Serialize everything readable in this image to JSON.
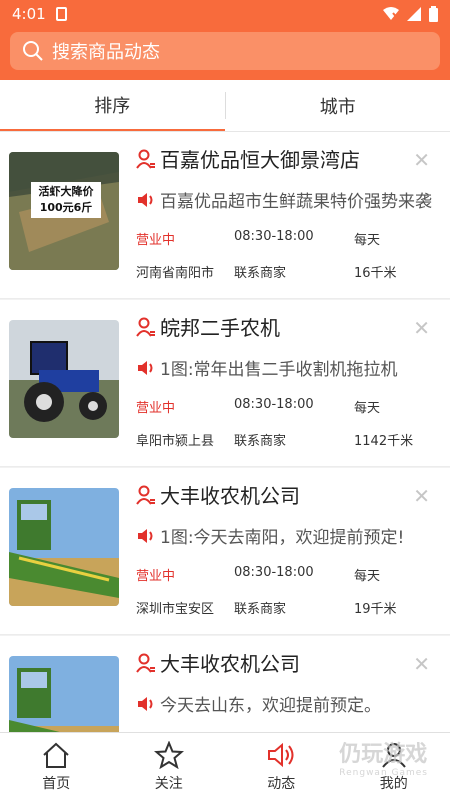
{
  "status_bar": {
    "time": "4:01"
  },
  "search": {
    "placeholder": "搜索商品动态"
  },
  "tabs": [
    {
      "label": "排序"
    },
    {
      "label": "城市"
    }
  ],
  "colors": {
    "accent": "#f86b3c",
    "open_status": "#e2312b"
  },
  "listings": [
    {
      "name": "百嘉优品恒大御景湾店",
      "promo": "百嘉优品超市生鲜蔬果特价强势来袭",
      "status": "营业中",
      "hours": "08:30-18:00",
      "days": "每天",
      "location": "河南省南阳市",
      "contact": "联系商家",
      "distance": "16千米",
      "image_text_line1": "活虾大降价",
      "image_text_line2": "100元6斤"
    },
    {
      "name": "皖邦二手农机",
      "promo": "1图:常年出售二手收割机拖拉机",
      "status": "营业中",
      "hours": "08:30-18:00",
      "days": "每天",
      "location": "阜阳市颍上县",
      "contact": "联系商家",
      "distance": "1142千米"
    },
    {
      "name": "大丰收农机公司",
      "promo": "1图:今天去南阳，欢迎提前预定!",
      "status": "营业中",
      "hours": "08:30-18:00",
      "days": "每天",
      "location": "深圳市宝安区",
      "contact": "联系商家",
      "distance": "19千米"
    },
    {
      "name": "大丰收农机公司",
      "promo": "今天去山东，欢迎提前预定。"
    }
  ],
  "bottom_nav": [
    {
      "label": "首页",
      "icon": "home-icon"
    },
    {
      "label": "关注",
      "icon": "star-icon"
    },
    {
      "label": "动态",
      "icon": "speaker-icon"
    },
    {
      "label": "我的",
      "icon": "user-icon"
    }
  ],
  "watermark": {
    "text": "仍玩游戏",
    "sub": "Rengwan Games"
  }
}
